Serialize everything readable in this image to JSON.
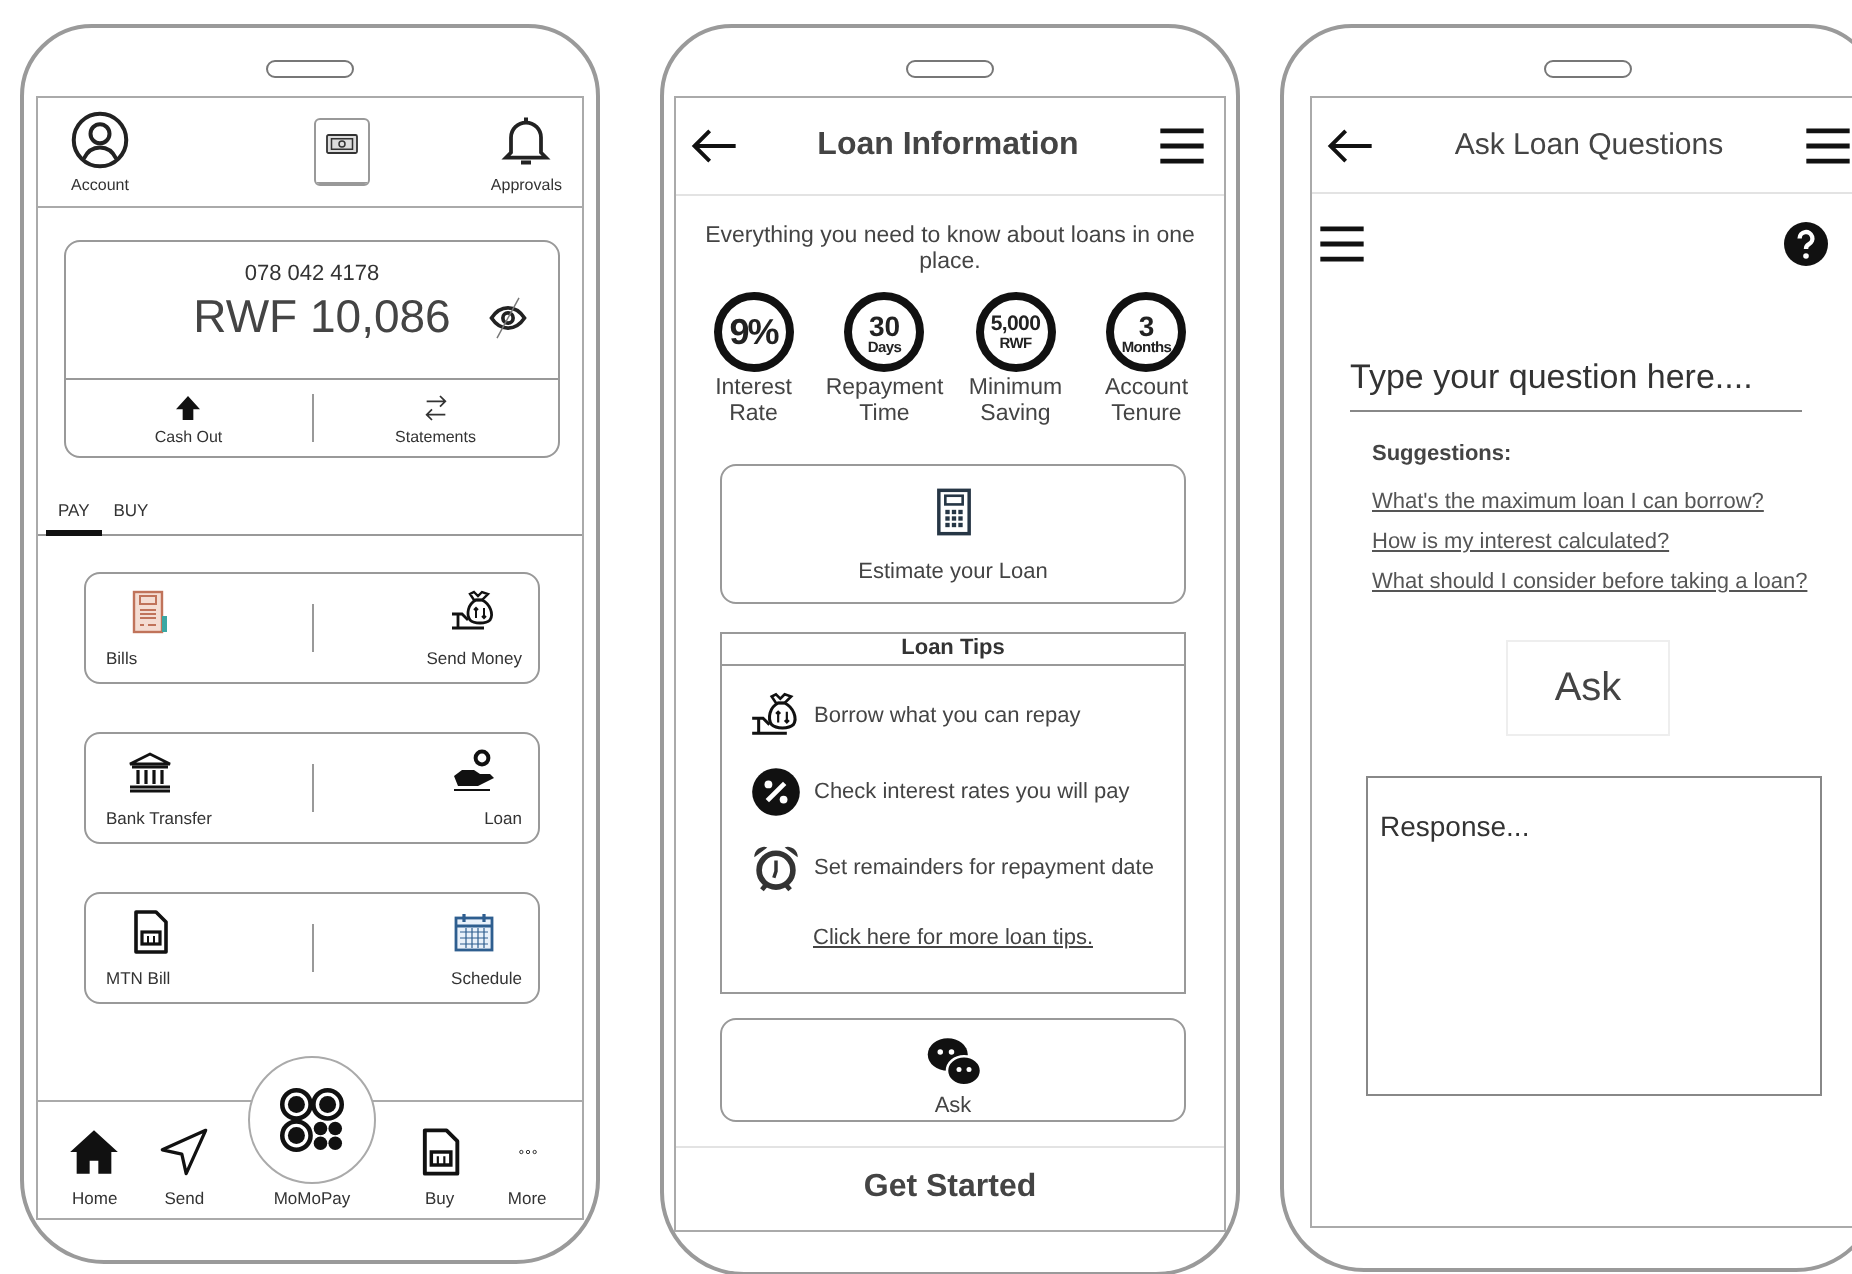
{
  "home_screen": {
    "header": {
      "account_label": "Account",
      "approvals_label": "Approvals"
    },
    "balance_card": {
      "phone_number": "078 042 4178",
      "balance": "RWF 10,086"
    },
    "actions": [
      {
        "label": "Cash Out",
        "kind": "cash-out"
      },
      {
        "label": "Statements",
        "kind": "statements"
      }
    ],
    "tabs": [
      {
        "label": "PAY",
        "selected": true
      },
      {
        "label": "BUY",
        "selected": false
      }
    ],
    "service_rows": [
      {
        "items": [
          {
            "label": "Bills",
            "kind": "bills"
          },
          {
            "label": "Send Money",
            "kind": "send-money"
          }
        ]
      },
      {
        "items": [
          {
            "label": "Bank Transfer",
            "kind": "bank"
          },
          {
            "label": "Loan",
            "kind": "loan"
          }
        ]
      },
      {
        "items": [
          {
            "label": "MTN Bill",
            "kind": "sim"
          },
          {
            "label": "Schedule",
            "kind": "calendar"
          }
        ]
      }
    ],
    "bottom_nav": [
      {
        "label": "Home",
        "kind": "home"
      },
      {
        "label": "Send",
        "kind": "send"
      },
      {
        "label": "MoMoPay",
        "kind": "momopay"
      },
      {
        "label": "Buy",
        "kind": "sim"
      },
      {
        "label": "More",
        "kind": "more"
      }
    ]
  },
  "loan_info_screen": {
    "title": "Loan Information",
    "intro": "Everything you need to know about loans in one place.",
    "stats": [
      {
        "value": "9%",
        "label": "Interest Rate"
      },
      {
        "value": "30",
        "unit": "Days",
        "label": "Repayment Time"
      },
      {
        "value": "5,000",
        "unit": "RWF",
        "label": "Minimum Saving"
      },
      {
        "value": "3",
        "unit": "Months",
        "label": "Account Tenure"
      }
    ],
    "estimate_button": "Estimate your Loan",
    "tips": {
      "title": "Loan Tips",
      "items": [
        {
          "text": "Borrow what you can repay",
          "kind": "send-money"
        },
        {
          "text": "Check interest rates you will pay",
          "kind": "percent"
        },
        {
          "text": "Set remainders for repayment date",
          "kind": "alarm"
        }
      ],
      "link": "Click here for more loan tips."
    },
    "ask_button": "Ask",
    "footer_button": "Get Started"
  },
  "ask_screen": {
    "title": "Ask Loan Questions",
    "question": {
      "placeholder": "Type your question here...."
    },
    "suggestions_label": "Suggestions:",
    "suggestions": [
      "What's the maximum loan I can borrow?",
      "How is my interest calculated?",
      "What should I consider before taking a loan?"
    ],
    "ask_button": "Ask",
    "response": {
      "placeholder": "Response..."
    }
  }
}
